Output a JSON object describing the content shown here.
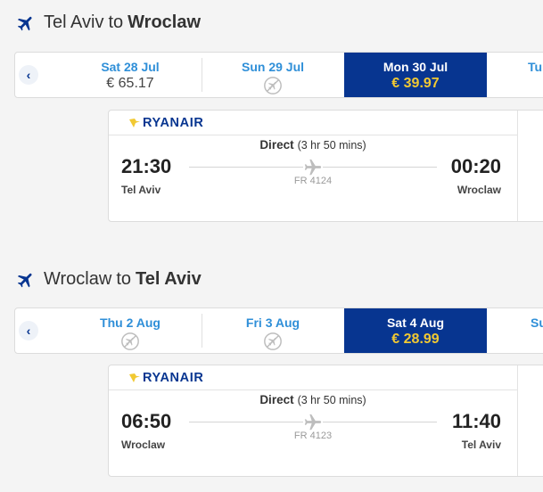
{
  "outbound": {
    "title_from": "Tel Aviv",
    "title_connector": "to",
    "title_to": "Wroclaw",
    "dates": [
      {
        "label": "Sat 28 Jul",
        "price": "€ 65.17",
        "available": true,
        "selected": false
      },
      {
        "label": "Sun 29 Jul",
        "price": "",
        "available": false,
        "selected": false
      },
      {
        "label": "Mon 30 Jul",
        "price": "€ 39.97",
        "available": true,
        "selected": true
      },
      {
        "label": "Tu",
        "price": "",
        "available": true,
        "selected": false
      }
    ],
    "flight": {
      "airline": "RYANAIR",
      "stops": "Direct",
      "duration": "(3 hr 50 mins)",
      "depart_time": "21:30",
      "arrive_time": "00:20",
      "depart_city": "Tel Aviv",
      "arrive_city": "Wroclaw",
      "flight_number": "FR 4124"
    }
  },
  "inbound": {
    "title_from": "Wroclaw",
    "title_connector": "to",
    "title_to": "Tel Aviv",
    "dates": [
      {
        "label": "Thu 2 Aug",
        "price": "",
        "available": false,
        "selected": false
      },
      {
        "label": "Fri 3 Aug",
        "price": "",
        "available": false,
        "selected": false
      },
      {
        "label": "Sat 4 Aug",
        "price": "€ 28.99",
        "available": true,
        "selected": true
      },
      {
        "label": "Su",
        "price": "",
        "available": true,
        "selected": false
      }
    ],
    "flight": {
      "airline": "RYANAIR",
      "stops": "Direct",
      "duration": "(3 hr 50 mins)",
      "depart_time": "06:50",
      "arrive_time": "11:40",
      "depart_city": "Wroclaw",
      "arrive_city": "Tel Aviv",
      "flight_number": "FR 4123"
    }
  },
  "icons": {
    "plane": "plane-icon",
    "no_flight": "no-flight-icon",
    "prev": "chevron-left-icon"
  },
  "colors": {
    "selected_bg": "#073590",
    "selected_price": "#f1c933",
    "date_label": "#2f8fd8",
    "brand": "#073590"
  }
}
